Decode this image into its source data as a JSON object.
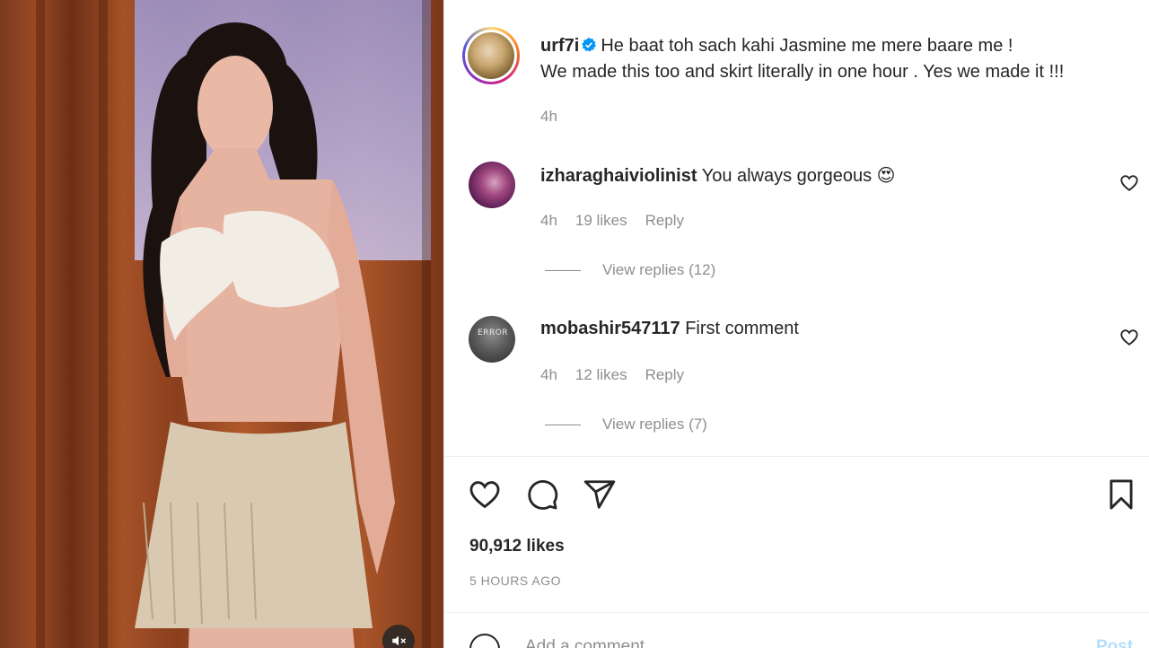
{
  "post": {
    "username": "urf7i",
    "caption_line1": "He baat toh sach kahi Jasmine me mere baare me !",
    "caption_line2": "We made this too and skirt literally in one hour . Yes we made it !!!",
    "time": "4h"
  },
  "comments": [
    {
      "username": "izharaghaiviolinist",
      "text": "You always gorgeous 😍",
      "time": "4h",
      "likes": "19 likes",
      "reply_label": "Reply",
      "view_replies": "View replies (12)"
    },
    {
      "username": "mobashir547117",
      "text": "First comment",
      "avatar_text": "ERROR",
      "time": "4h",
      "likes": "12 likes",
      "reply_label": "Reply",
      "view_replies": "View replies (7)"
    }
  ],
  "actions": {
    "icons": [
      "heart-icon",
      "comment-icon",
      "share-icon",
      "bookmark-icon"
    ]
  },
  "likes_count": "90,912 likes",
  "posted_ago": "5 HOURS AGO",
  "add_comment": {
    "placeholder": "Add a comment...",
    "post_label": "Post"
  },
  "colors": {
    "text": "#262626",
    "secondary": "#8e8e8e",
    "verified": "#0095f6",
    "post_disabled": "#b2dffc"
  }
}
